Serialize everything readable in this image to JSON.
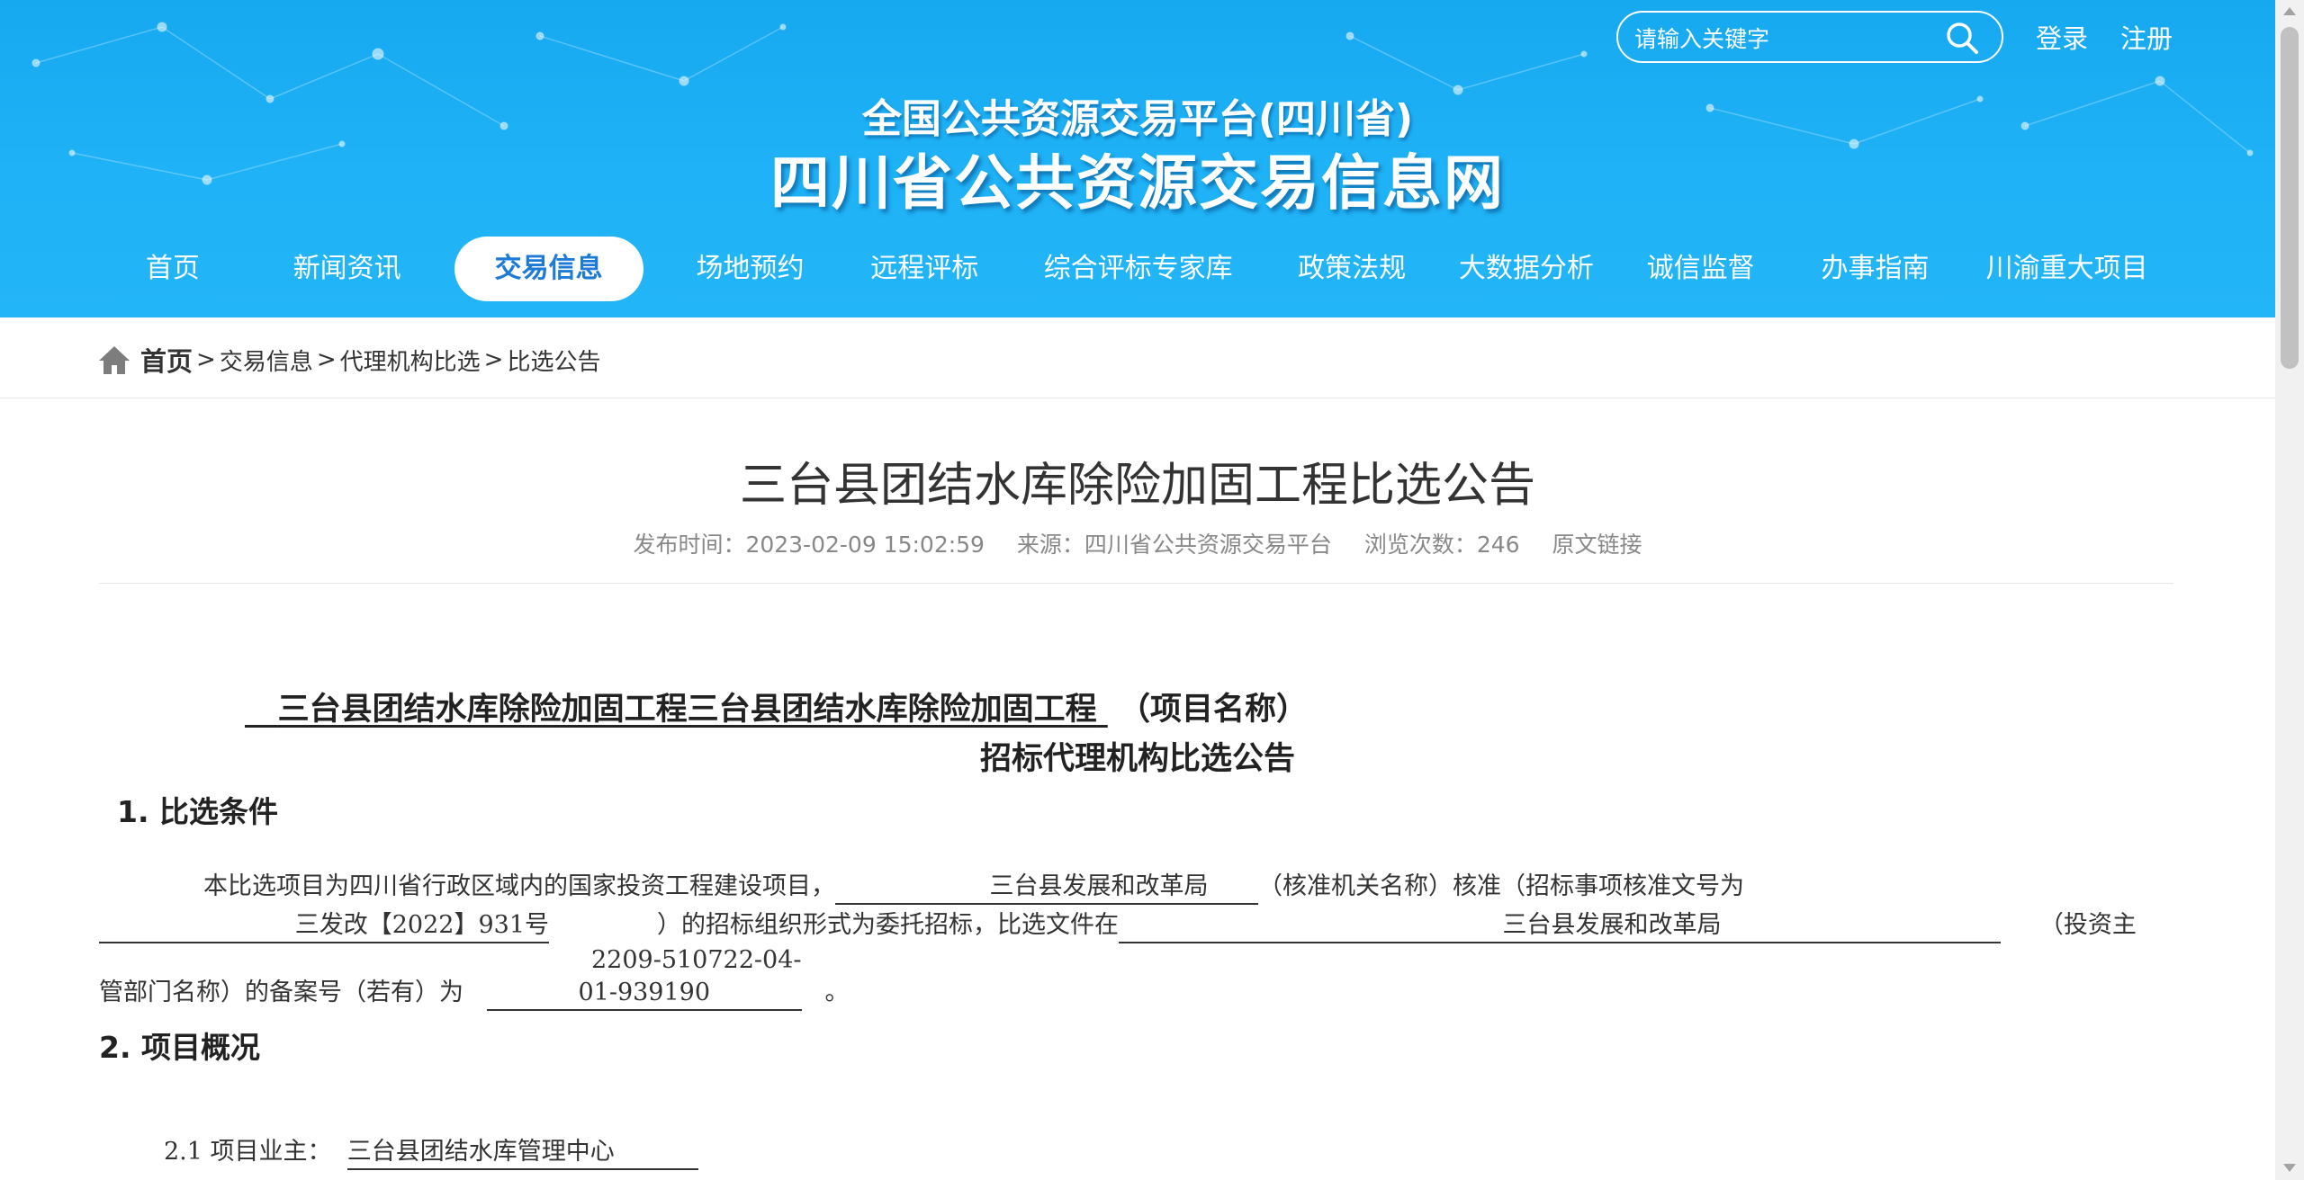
{
  "header": {
    "search_placeholder": "请输入关键字",
    "login": "登录",
    "register": "注册",
    "subtitle": "全国公共资源交易平台(四川省)",
    "title": "四川省公共资源交易信息网"
  },
  "nav": {
    "items": [
      "首页",
      "新闻资讯",
      "交易信息",
      "场地预约",
      "远程评标",
      "综合评标专家库",
      "政策法规",
      "大数据分析",
      "诚信监督",
      "办事指南",
      "川渝重大项目"
    ],
    "active": "交易信息"
  },
  "breadcrumb": {
    "home": "首页",
    "items": [
      "交易信息",
      "代理机构比选",
      "比选公告"
    ],
    "separator": ">"
  },
  "article": {
    "title": "三台县团结水库除险加固工程比选公告",
    "publish_time": "发布时间：2023-02-09 15:02:59",
    "source": "来源：四川省公共资源交易平台",
    "views": "浏览次数：246",
    "origin_link": "原文链接"
  },
  "document": {
    "project_name": "三台县团结水库除险加固工程三台县团结水库除险加固工程",
    "project_name_suffix": "（项目名称）",
    "heading": "招标代理机构比选公告",
    "section1_title": "1.  比选条件",
    "p1_a": "本比选项目为四川省行政区域内的国家投资工程建设项目，",
    "p1_approver": "三台县发展和改革局",
    "p1_b": "（核准机关名称）核准（招标事项核准文号为",
    "p1_docno": "三发改【2022】931号",
    "p1_c": "）的招标组织形式为委托招标，比选文件在",
    "p1_dept": "三台县发展和改革局",
    "p1_d": "（投资主管部门名称）的备案号（若有）为",
    "p1_record": "2209-510722-04-01-939190",
    "p1_e": "。",
    "section2_title": "2.  项目概况",
    "item21_label": "2.1  项目业主：",
    "item21_value": "三台县团结水库管理中心"
  },
  "colors": {
    "header_blue": "#1fb2f6",
    "nav_active_text": "#1d7ad6"
  },
  "icons": [
    "search-icon",
    "home-icon"
  ]
}
